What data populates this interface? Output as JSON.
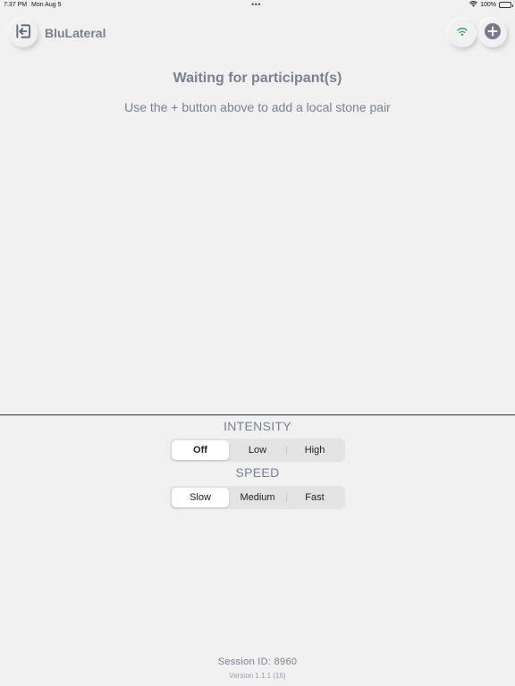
{
  "status_bar": {
    "time": "7:37 PM",
    "date": "Mon Aug 5",
    "dots": "•••",
    "battery": "100%"
  },
  "nav": {
    "title": "BluLateral",
    "icons": {
      "exit": "exit-arrow-icon",
      "wifi": "wifi-icon",
      "add": "plus-circle-icon"
    }
  },
  "main": {
    "title": "Waiting for participant(s)",
    "subtitle": "Use the + button above to add a local stone pair"
  },
  "controls": {
    "intensity": {
      "label": "INTENSITY",
      "options": [
        "Off",
        "Low",
        "High"
      ],
      "selected": "Off"
    },
    "speed": {
      "label": "SPEED",
      "options": [
        "Slow",
        "Medium",
        "Fast"
      ],
      "selected": "Slow"
    }
  },
  "footer": {
    "session": "Session ID: 8960",
    "version": "Version 1.1.1 (16)"
  },
  "colors": {
    "text": "#7a8192",
    "background": "#f0f0f0",
    "wifi": "#3cb043",
    "add": "#737c8f"
  }
}
